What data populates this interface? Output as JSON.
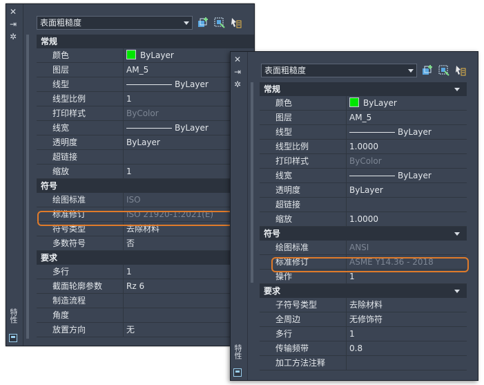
{
  "palettes": [
    {
      "combo_value": "表面粗糙度",
      "side_title": "特性",
      "sections": [
        {
          "title": "常规",
          "rows": [
            {
              "name": "颜色",
              "value": "ByLayer",
              "kind": "color",
              "swatch": "#00e600"
            },
            {
              "name": "图层",
              "value": "AM_5",
              "kind": "text"
            },
            {
              "name": "线型",
              "value": "ByLayer",
              "kind": "linetype"
            },
            {
              "name": "线型比例",
              "value": "1",
              "kind": "text"
            },
            {
              "name": "打印样式",
              "value": "ByColor",
              "kind": "dim"
            },
            {
              "name": "线宽",
              "value": "ByLayer",
              "kind": "linetype"
            },
            {
              "name": "透明度",
              "value": "ByLayer",
              "kind": "text"
            },
            {
              "name": "超链接",
              "value": "",
              "kind": "text"
            },
            {
              "name": "缩放",
              "value": "1",
              "kind": "text"
            }
          ]
        },
        {
          "title": "符号",
          "rows": [
            {
              "name": "绘图标准",
              "value": "ISO",
              "kind": "dim"
            },
            {
              "name": "标准修订",
              "value": "ISO 21920-1:2021(E)",
              "kind": "dim"
            },
            {
              "name": "符号类型",
              "value": "去除材料",
              "kind": "text"
            },
            {
              "name": "多数符号",
              "value": "否",
              "kind": "text"
            }
          ]
        },
        {
          "title": "要求",
          "rows": [
            {
              "name": "多行",
              "value": "1",
              "kind": "text"
            },
            {
              "name": "截面轮廓参数",
              "value": "Rz 6",
              "kind": "text"
            },
            {
              "name": "制造流程",
              "value": "",
              "kind": "text"
            },
            {
              "name": "角度",
              "value": "",
              "kind": "text"
            },
            {
              "name": "放置方向",
              "value": "无",
              "kind": "text"
            }
          ]
        }
      ]
    },
    {
      "combo_value": "表面粗糙度",
      "side_title": "特性",
      "sections": [
        {
          "title": "常规",
          "rows": [
            {
              "name": "颜色",
              "value": "ByLayer",
              "kind": "color",
              "swatch": "#00e600"
            },
            {
              "name": "图层",
              "value": "AM_5",
              "kind": "text"
            },
            {
              "name": "线型",
              "value": "ByLayer",
              "kind": "linetype"
            },
            {
              "name": "线型比例",
              "value": "1.0000",
              "kind": "text"
            },
            {
              "name": "打印样式",
              "value": "ByColor",
              "kind": "dim"
            },
            {
              "name": "线宽",
              "value": "ByLayer",
              "kind": "linetype"
            },
            {
              "name": "透明度",
              "value": "ByLayer",
              "kind": "text"
            },
            {
              "name": "超链接",
              "value": "",
              "kind": "text"
            },
            {
              "name": "缩放",
              "value": "1.0000",
              "kind": "text"
            }
          ]
        },
        {
          "title": "符号",
          "rows": [
            {
              "name": "绘图标准",
              "value": "ANSI",
              "kind": "dim"
            },
            {
              "name": "标准修订",
              "value": "ASME Y14.36 - 2018",
              "kind": "dim"
            },
            {
              "name": "操作",
              "value": "1",
              "kind": "text"
            }
          ]
        },
        {
          "title": "要求",
          "rows": [
            {
              "name": "子符号类型",
              "value": "去除材料",
              "kind": "text"
            },
            {
              "name": "全周边",
              "value": "无修饰符",
              "kind": "text"
            },
            {
              "name": "多行",
              "value": "1",
              "kind": "text"
            },
            {
              "name": "传输频带",
              "value": "0.8",
              "kind": "text"
            },
            {
              "name": "加工方法注释",
              "value": "",
              "kind": "text"
            }
          ]
        }
      ]
    }
  ],
  "highlight_color": "#e07b2a"
}
